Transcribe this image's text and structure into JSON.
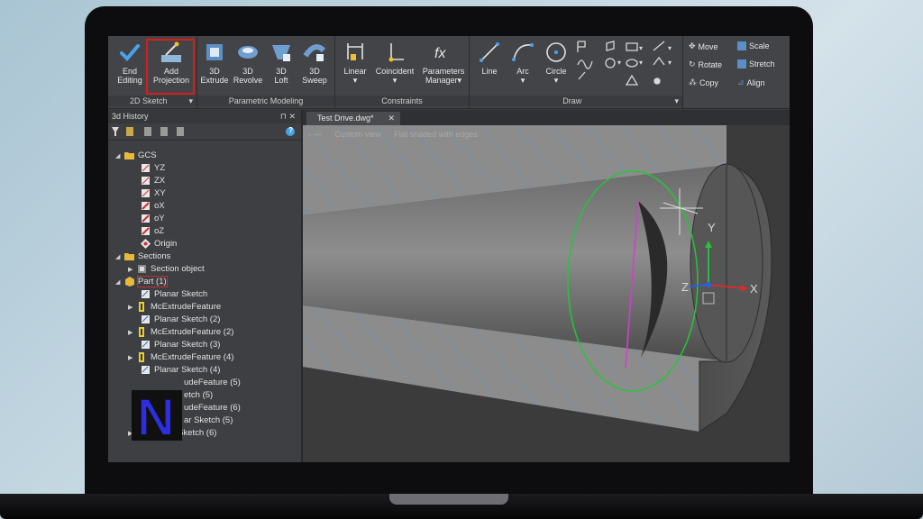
{
  "ribbon": {
    "groups": [
      {
        "label": "2D Sketch"
      },
      {
        "label": "Parametric Modeling"
      },
      {
        "label": "Constraints"
      },
      {
        "label": "Draw"
      }
    ],
    "buttons": {
      "end_editing": {
        "line1": "End",
        "line2": "Editing"
      },
      "add_projection": {
        "line1": "Add",
        "line2": "Projection"
      },
      "extrude": {
        "line1": "3D",
        "line2": "Extrude"
      },
      "revolve": {
        "line1": "3D",
        "line2": "Revolve"
      },
      "loft": {
        "line1": "3D",
        "line2": "Loft"
      },
      "sweep": {
        "line1": "3D",
        "line2": "Sweep"
      },
      "linear": {
        "line1": "Linear",
        "line2": "▾"
      },
      "coincident": {
        "line1": "Coincident",
        "line2": "▾"
      },
      "parameters": {
        "line1": "Parameters",
        "line2": "Manager▾"
      },
      "line": {
        "line1": "Line",
        "line2": ""
      },
      "arc": {
        "line1": "Arc",
        "line2": "▾"
      },
      "circle": {
        "line1": "Circle",
        "line2": "▾"
      }
    },
    "modify": {
      "move": "Move",
      "scale": "Scale",
      "rotate": "Rotate",
      "stretch": "Stretch",
      "copy": "Copy",
      "align": "Align"
    },
    "colors": {
      "highlight": "#d51e1e",
      "background": "#434447"
    }
  },
  "history_panel": {
    "title": "3d History",
    "pins": "⊓ ✕",
    "help": "?",
    "tree": [
      {
        "label": "GCS",
        "icon": "folder-icon"
      },
      {
        "label": "YZ",
        "icon": "plane-icon"
      },
      {
        "label": "ZX",
        "icon": "plane-icon"
      },
      {
        "label": "XY",
        "icon": "plane-icon"
      },
      {
        "label": "oX",
        "icon": "axis-icon"
      },
      {
        "label": "oY",
        "icon": "axis-icon"
      },
      {
        "label": "oZ",
        "icon": "axis-icon"
      },
      {
        "label": "Origin",
        "icon": "origin-icon"
      },
      {
        "label": "Sections",
        "icon": "folder-icon"
      },
      {
        "label": "Section object",
        "icon": "section-icon"
      },
      {
        "label": "Part (1)",
        "icon": "part-icon"
      },
      {
        "label": "Planar Sketch",
        "icon": "sketch-icon"
      },
      {
        "label": "McExtrudeFeature",
        "icon": "extrude-icon"
      },
      {
        "label": "Planar Sketch (2)",
        "icon": "sketch-icon"
      },
      {
        "label": "McExtrudeFeature (2)",
        "icon": "extrude-icon"
      },
      {
        "label": "Planar Sketch (3)",
        "icon": "sketch-icon"
      },
      {
        "label": "McExtrudeFeature (4)",
        "icon": "extrude-icon"
      },
      {
        "label": "Planar Sketch (4)",
        "icon": "sketch-icon"
      },
      {
        "label": "udeFeature (5)",
        "icon": "extrude-icon"
      },
      {
        "label": "etch (5)",
        "icon": "sketch-icon"
      },
      {
        "label": "udeFeature (6)",
        "icon": "extrude-icon"
      },
      {
        "label": "ar Sketch (5)",
        "icon": "sketch-icon"
      },
      {
        "label": "Planar Sketch (6)",
        "icon": "sketch-icon"
      }
    ]
  },
  "viewport": {
    "tab_title": "Test Drive.dwg*",
    "tab_close": "✕",
    "view_mode": "Custom view",
    "shading_mode": "Flat shaded with edges",
    "axis_labels": {
      "x": "X",
      "y": "Y",
      "z": "Z"
    }
  },
  "watermark": {
    "letter": "N"
  }
}
